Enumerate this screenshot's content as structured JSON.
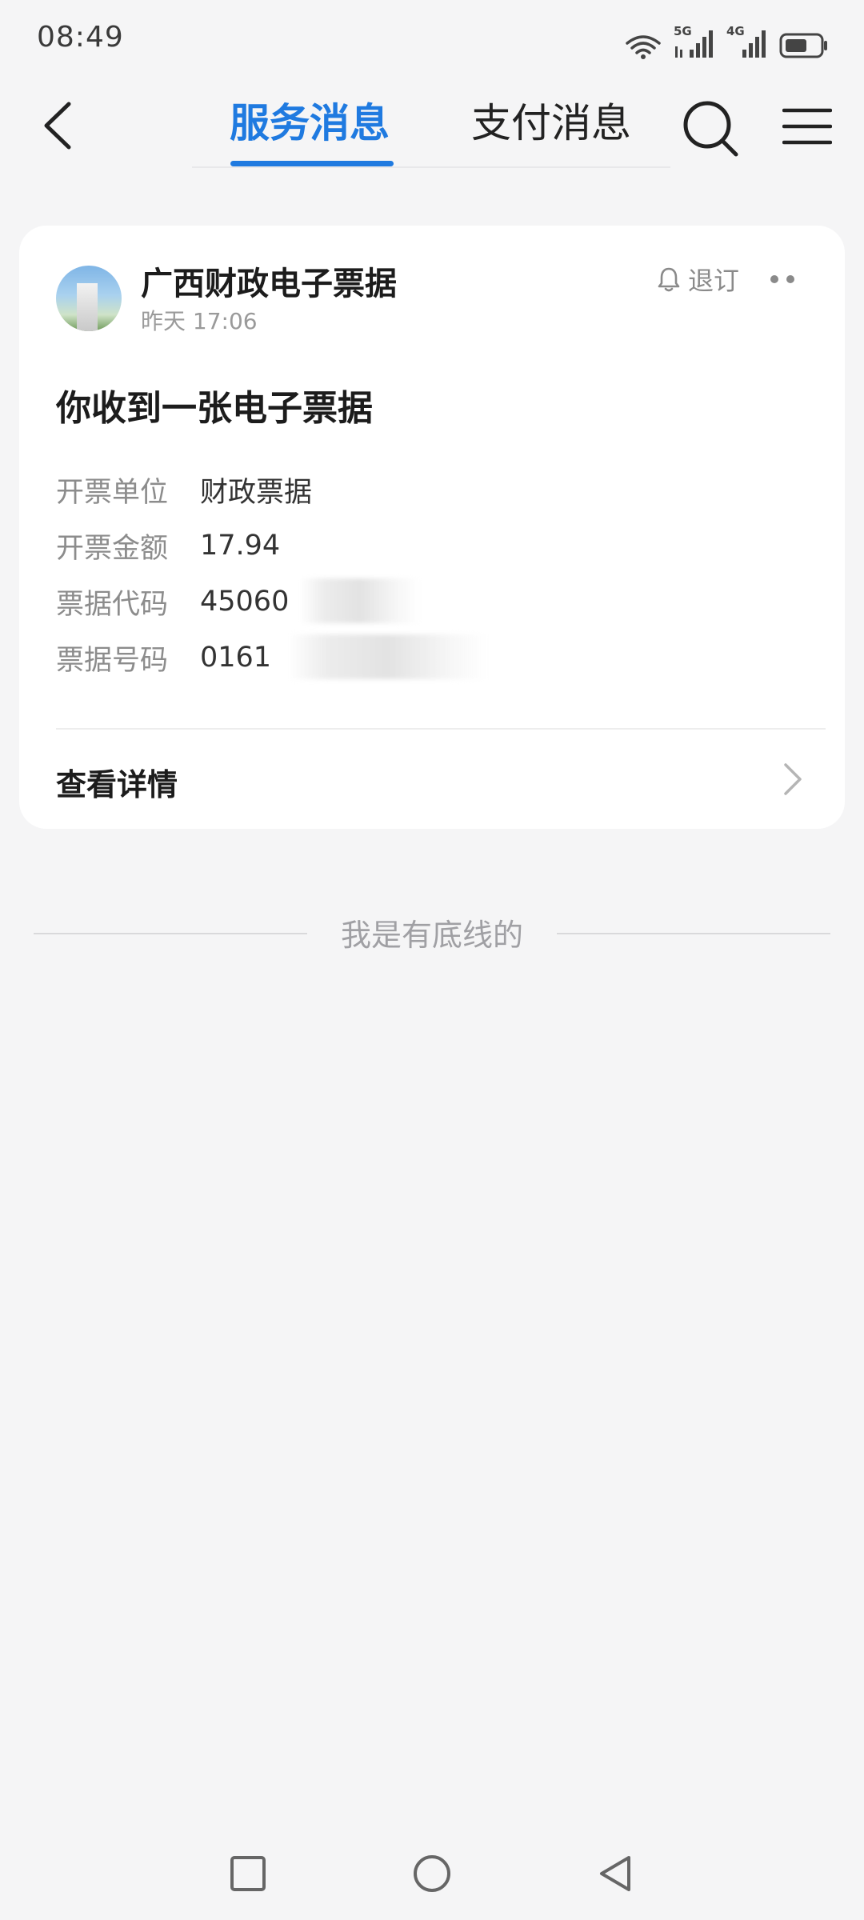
{
  "status_bar": {
    "time": "08:49",
    "icons": [
      "wifi-icon",
      "signal-5g-icon",
      "signal-4g-icon",
      "battery-icon"
    ],
    "signal_5g_label": "5G",
    "signal_4g_label": "4G"
  },
  "header": {
    "tabs": [
      {
        "label": "服务消息",
        "active": true
      },
      {
        "label": "支付消息",
        "active": false
      }
    ],
    "accent_color": "#1f7ae0"
  },
  "card": {
    "sender_name": "广西财政电子票据",
    "timestamp": "昨天 17:06",
    "unsubscribe_label": "退订",
    "title": "你收到一张电子票据",
    "fields": [
      {
        "label": "开票单位",
        "value": "财政票据"
      },
      {
        "label": "开票金额",
        "value": "17.94"
      },
      {
        "label": "票据代码",
        "value": "45060"
      },
      {
        "label": "票据号码",
        "value": "0161"
      }
    ],
    "details_label": "查看详情"
  },
  "footer": {
    "end_text": "我是有底线的"
  }
}
